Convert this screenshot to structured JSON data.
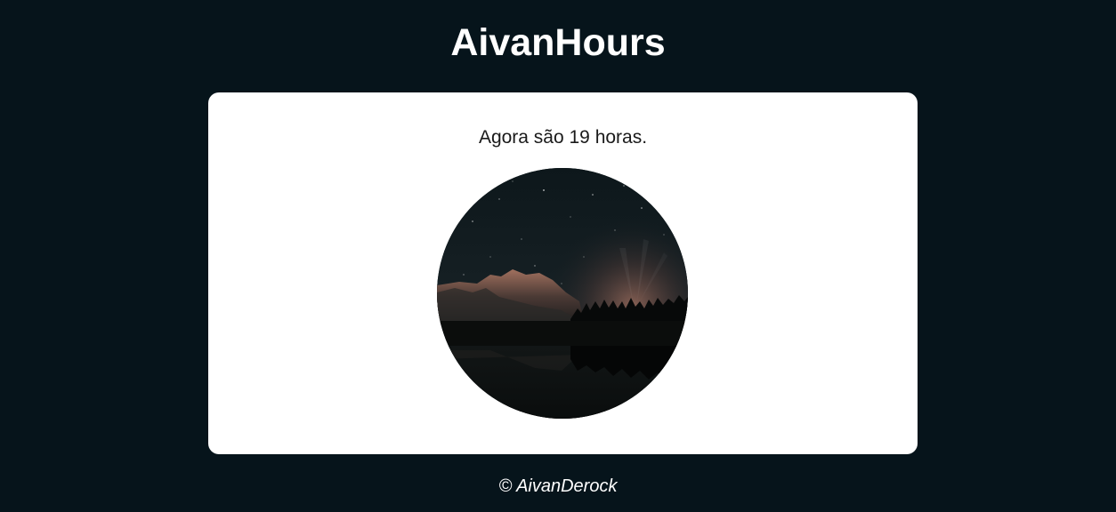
{
  "header": {
    "title": "AivanHours"
  },
  "main": {
    "message": "Agora são 19 horas.",
    "image": {
      "icon": "night-landscape-image",
      "description_hidden": true
    }
  },
  "footer": {
    "text": "© AivanDerock"
  },
  "colors": {
    "background": "#06141b",
    "card": "#ffffff",
    "title": "#ffffff",
    "message": "#1a1a1a",
    "footer": "#ffffff"
  }
}
